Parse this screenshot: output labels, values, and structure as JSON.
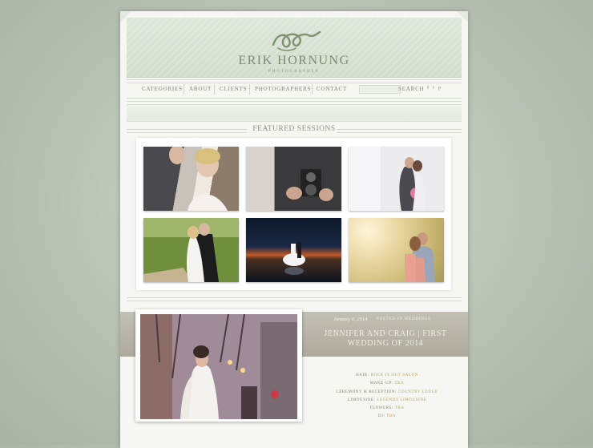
{
  "site": {
    "brand": "ERIK HORNUNG",
    "tagline": "PHOTOGRAPHER"
  },
  "nav": {
    "items": [
      "CATEGORIES",
      "ABOUT",
      "CLIENTS",
      "PHOTOGRAPHERS",
      "CONTACT"
    ],
    "search_placeholder": "",
    "search_label": "SEARCH",
    "social": [
      "f",
      "t",
      "p"
    ]
  },
  "featured": {
    "title": "FEATURED SESSIONS"
  },
  "post": {
    "date": "January 6, 2014",
    "category": "POSTED IN WEDDINGS",
    "title": "JENNIFER AND CRAIG | FIRST WEDDING OF 2014",
    "credits": [
      {
        "label": "HAIR:",
        "value": "ROCK IT OUT SALON"
      },
      {
        "label": "MAKE-UP:",
        "value": "TBA"
      },
      {
        "label": "CEREMONY & RECEPTION:",
        "value": "COUNTRY LODGE"
      },
      {
        "label": "LIMOUSINE:",
        "value": "LEGENDS LIMOUSINE"
      },
      {
        "label": "FLOWERS:",
        "value": "TBA"
      },
      {
        "label": "DJ:",
        "value": "TBA"
      }
    ]
  },
  "colors": {
    "background": "#b9c2b4",
    "header": "#dce3d6",
    "accent_gold": "#b2a662",
    "band": "#b8b4a8"
  }
}
